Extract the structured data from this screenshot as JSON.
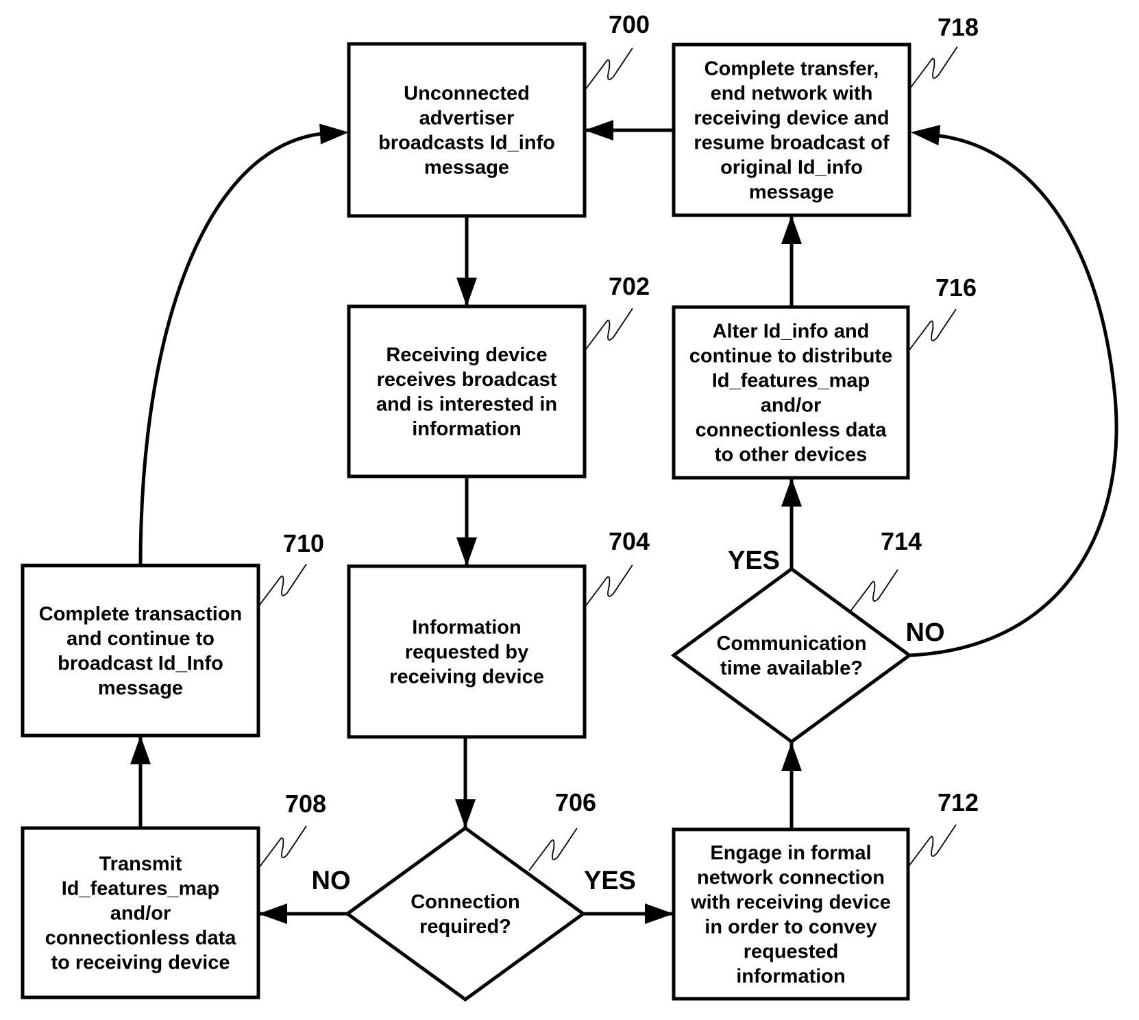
{
  "diagram": {
    "nodes": [
      {
        "id": "700",
        "type": "process",
        "lines": [
          "Unconnected",
          "advertiser",
          "broadcasts Id_info",
          "message"
        ]
      },
      {
        "id": "702",
        "type": "process",
        "lines": [
          "Receiving device",
          "receives broadcast",
          "and is interested in",
          "information"
        ]
      },
      {
        "id": "704",
        "type": "process",
        "lines": [
          "Information",
          "requested by",
          "receiving device"
        ]
      },
      {
        "id": "706",
        "type": "decision",
        "lines": [
          "Connection",
          "required?"
        ]
      },
      {
        "id": "708",
        "type": "process",
        "lines": [
          "Transmit",
          "Id_features_map",
          "and/or",
          "connectionless data",
          "to receiving device"
        ]
      },
      {
        "id": "710",
        "type": "process",
        "lines": [
          "Complete transaction",
          "and continue to",
          "broadcast Id_Info",
          "message"
        ]
      },
      {
        "id": "712",
        "type": "process",
        "lines": [
          "Engage in formal",
          "network connection",
          "with receiving device",
          "in order to convey",
          "requested",
          "information"
        ]
      },
      {
        "id": "714",
        "type": "decision",
        "lines": [
          "Communication",
          "time available?"
        ]
      },
      {
        "id": "716",
        "type": "process",
        "lines": [
          "Alter Id_info and",
          "continue to distribute",
          "Id_features_map",
          "and/or",
          "connectionless data",
          "to  other devices"
        ]
      },
      {
        "id": "718",
        "type": "process",
        "lines": [
          "Complete transfer,",
          "end network with",
          "receiving device and",
          "resume broadcast of",
          "original Id_info",
          "message"
        ]
      }
    ],
    "edges": [
      {
        "from": "700",
        "to": "702",
        "label": ""
      },
      {
        "from": "702",
        "to": "704",
        "label": ""
      },
      {
        "from": "704",
        "to": "706",
        "label": ""
      },
      {
        "from": "706",
        "to": "708",
        "label": "NO"
      },
      {
        "from": "706",
        "to": "712",
        "label": "YES"
      },
      {
        "from": "708",
        "to": "710",
        "label": ""
      },
      {
        "from": "710",
        "to": "700",
        "label": ""
      },
      {
        "from": "712",
        "to": "714",
        "label": ""
      },
      {
        "from": "714",
        "to": "716",
        "label": "YES"
      },
      {
        "from": "714",
        "to": "718",
        "label": "NO"
      },
      {
        "from": "716",
        "to": "718",
        "label": ""
      },
      {
        "from": "718",
        "to": "700",
        "label": ""
      }
    ]
  }
}
